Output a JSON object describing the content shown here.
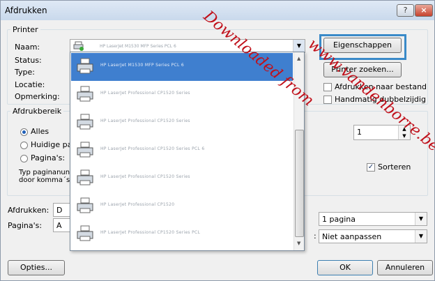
{
  "window": {
    "title": "Afdrukken",
    "help_label": "?",
    "close_label": "×"
  },
  "printer": {
    "group_label": "Printer",
    "name_label": "Naam:",
    "status_label": "Status:",
    "type_label": "Type:",
    "location_label": "Locatie:",
    "comment_label": "Opmerking:",
    "selected_name": "HP LaserJet M1530 MFP Series PCL 6",
    "properties_button": "Eigenschappen",
    "find_button": "Printer zoeken...",
    "print_to_file": "Afdrukken naar bestand",
    "manual_duplex": "Handmatig dubbelzijdig",
    "print_to_file_checked": false,
    "manual_duplex_checked": false
  },
  "dropdown": {
    "items": [
      {
        "name": "HP LaserJet M1530 MFP Series PCL 6",
        "selected": true
      },
      {
        "name": "HP LaserJet Professional CP1520 Series",
        "selected": false
      },
      {
        "name": "HP LaserJet Professional CP1520 Series",
        "selected": false
      },
      {
        "name": "HP LaserJet Professional CP1520 Series PCL 6",
        "selected": false
      },
      {
        "name": "HP LaserJet Professional CP1520 Series",
        "selected": false
      },
      {
        "name": "HP LaserJet Professional CP1520",
        "selected": false
      },
      {
        "name": "HP LaserJet Professional CP1520 Series PCL",
        "selected": false
      }
    ]
  },
  "range": {
    "group_label": "Afdrukbereik",
    "all_label": "Alles",
    "current_label": "Huidige pa",
    "pages_label": "Pagina's:",
    "hint_line1": "Typ paginanun",
    "hint_line2": "door komma´s",
    "selected": "all"
  },
  "copies": {
    "count": "1",
    "collate_label": "Sorteren",
    "collate_checked": true
  },
  "bottom": {
    "print_label": "Afdrukken:",
    "print_value": "D",
    "pages_label": "Pagina's:",
    "pages_value": "A",
    "per_sheet_value": "1 pagina",
    "scale_value": "Niet aanpassen",
    "colon": ":",
    "options_button": "Opties...",
    "ok_button": "OK",
    "cancel_button": "Annuleren"
  },
  "watermark": {
    "part1": "Downloaded from",
    "part2": "www.vandenborre.be"
  }
}
